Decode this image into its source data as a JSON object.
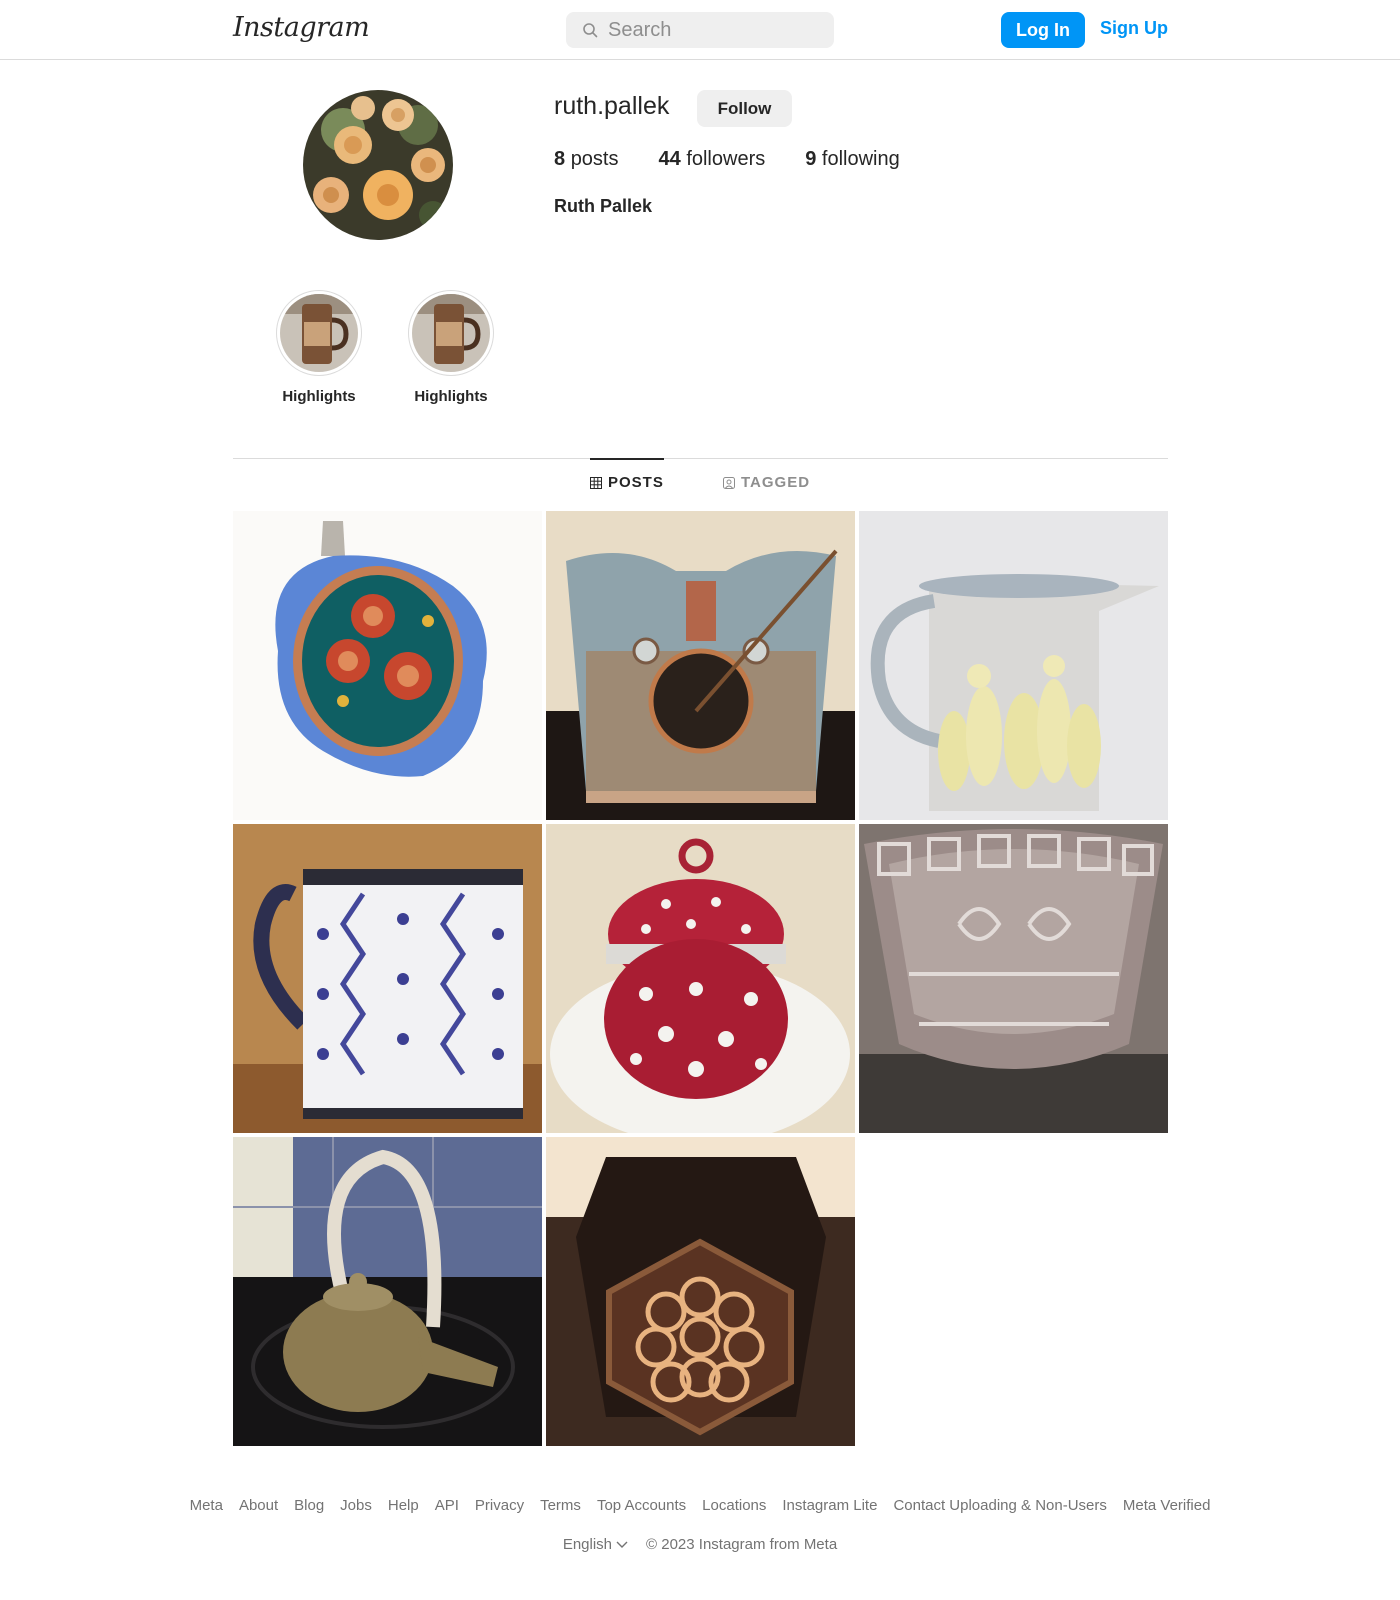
{
  "header": {
    "logo": "Instagram",
    "search_placeholder": "Search",
    "login_label": "Log In",
    "signup_label": "Sign Up",
    "accent_color": "#0095f6"
  },
  "profile": {
    "username": "ruth.pallek",
    "follow_label": "Follow",
    "posts_count": "8",
    "posts_label": "posts",
    "followers_count": "44",
    "followers_label": "followers",
    "following_count": "9",
    "following_label": "following",
    "full_name": "Ruth Pallek"
  },
  "highlights": [
    {
      "label": "Highlights"
    },
    {
      "label": "Highlights"
    }
  ],
  "tabs": {
    "posts_label": "POSTS",
    "tagged_label": "TAGGED"
  },
  "posts": [
    {
      "icon": "blue-enamel-pendant-image"
    },
    {
      "icon": "stoneware-cat-jar-image"
    },
    {
      "icon": "duck-pitcher-image"
    },
    {
      "icon": "blue-zigzag-mug-image"
    },
    {
      "icon": "red-polka-dot-jar-image"
    },
    {
      "icon": "lattice-clay-bowl-image"
    },
    {
      "icon": "teapot-with-cane-handle-image"
    },
    {
      "icon": "hexagonal-lattice-lantern-image"
    }
  ],
  "footer": {
    "links": [
      "Meta",
      "About",
      "Blog",
      "Jobs",
      "Help",
      "API",
      "Privacy",
      "Terms",
      "Top Accounts",
      "Locations",
      "Instagram Lite",
      "Contact Uploading & Non-Users",
      "Meta Verified"
    ],
    "language": "English",
    "copyright": "© 2023 Instagram from Meta"
  }
}
